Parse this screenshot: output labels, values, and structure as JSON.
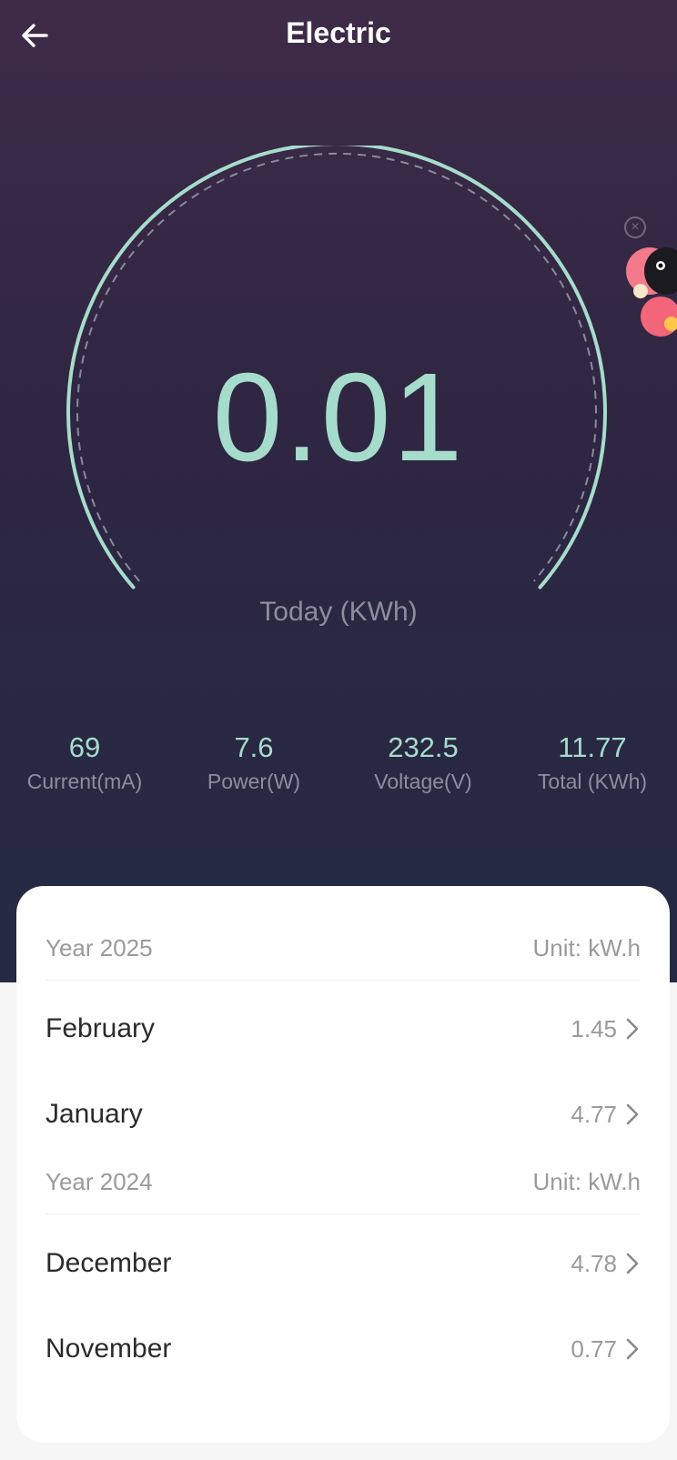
{
  "header": {
    "title": "Electric"
  },
  "gauge": {
    "value": "0.01",
    "label": "Today (KWh)",
    "accent": "#a6dccb"
  },
  "stats": [
    {
      "value": "69",
      "label": "Current(mA)"
    },
    {
      "value": "7.6",
      "label": "Power(W)"
    },
    {
      "value": "232.5",
      "label": "Voltage(V)"
    },
    {
      "value": "11.77",
      "label": "Total (KWh)"
    }
  ],
  "history": {
    "groups": [
      {
        "year": "Year 2025",
        "unit": "Unit: kW.h",
        "months": [
          {
            "name": "February",
            "value": "1.45"
          },
          {
            "name": "January",
            "value": "4.77"
          }
        ]
      },
      {
        "year": "Year 2024",
        "unit": "Unit: kW.h",
        "months": [
          {
            "name": "December",
            "value": "4.78"
          },
          {
            "name": "November",
            "value": "0.77"
          }
        ]
      }
    ]
  }
}
